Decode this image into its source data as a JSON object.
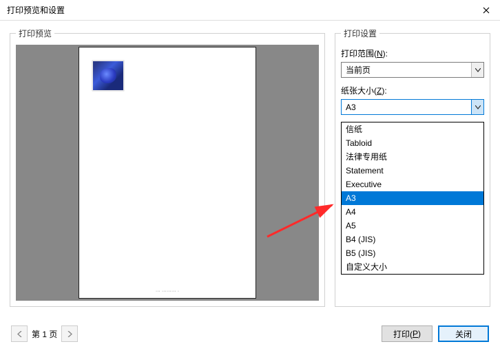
{
  "window": {
    "title": "打印预览和设置"
  },
  "preview": {
    "legend": "打印预览",
    "page_caption": "··· ········· ·"
  },
  "settings": {
    "legend": "打印设置",
    "print_range": {
      "label_pre": "打印范围(",
      "hotkey": "N",
      "label_post": "):",
      "value": "当前页"
    },
    "paper_size": {
      "label_pre": "纸张大小(",
      "hotkey": "Z",
      "label_post": "):",
      "value": "A3",
      "options": [
        "信纸",
        "Tabloid",
        "法律专用纸",
        "Statement",
        "Executive",
        "A3",
        "A4",
        "A5",
        "B4 (JIS)",
        "B5 (JIS)",
        "自定义大小"
      ],
      "selected": "A3"
    }
  },
  "pager": {
    "label": "第 1 页"
  },
  "buttons": {
    "print_pre": "打印(",
    "print_hot": "P",
    "print_post": ")",
    "close": "关闭"
  }
}
